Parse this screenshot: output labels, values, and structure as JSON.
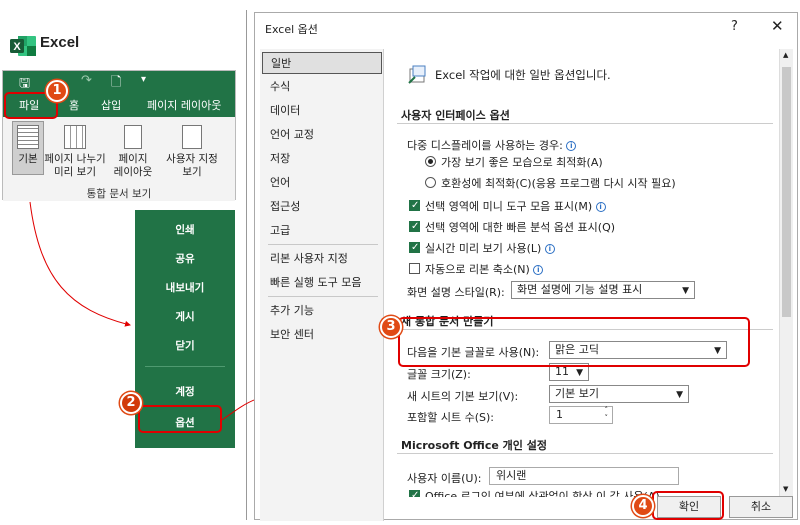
{
  "app": {
    "name": "Excel"
  },
  "ribbon": {
    "qat": {
      "save_icon": "save-icon",
      "undo_icon": "undo-icon",
      "redo_icon": "redo-icon",
      "preview_icon": "print-preview-icon",
      "more": "▾"
    },
    "tabs": [
      {
        "label": "파일"
      },
      {
        "label": "홈"
      },
      {
        "label": "삽입"
      },
      {
        "label": "페이지 레이아웃"
      }
    ],
    "view_buttons": [
      {
        "label_1": "기본",
        "label_2": ""
      },
      {
        "label_1": "페이지 나누기",
        "label_2": "미리 보기"
      },
      {
        "label_1": "페이지",
        "label_2": "레이아웃"
      },
      {
        "label_1": "사용자 지정",
        "label_2": "보기"
      }
    ],
    "group_label": "통합 문서 보기"
  },
  "backstage": {
    "items": [
      "인쇄",
      "공유",
      "내보내기",
      "게시",
      "닫기"
    ],
    "bottom_items": [
      "계정",
      "옵션"
    ]
  },
  "dialog": {
    "title": "Excel 옵션",
    "help": "?",
    "close": "✕",
    "nav": [
      "일반",
      "수식",
      "데이터",
      "언어 교정",
      "저장",
      "언어",
      "접근성",
      "고급",
      "리본 사용자 지정",
      "빠른 실행 도구 모음",
      "추가 기능",
      "보안 센터"
    ],
    "header_text": "Excel 작업에 대한 일반 옵션입니다.",
    "ui_section": {
      "title": "사용자 인터페이스 옵션",
      "multi_display_label": "다중 디스플레이를 사용하는 경우:",
      "radio_optimize": "가장 보기 좋은 모습으로 최적화(A)",
      "radio_compat": "호환성에 최적화(C)(응용 프로그램 다시 시작 필요)",
      "chk_mini_toolbar": "선택 영역에 미니 도구 모음 표시(M)",
      "chk_quick_analysis": "선택 영역에 대한 빠른 분석 옵션 표시(Q)",
      "chk_live_preview": "실시간 미리 보기 사용(L)",
      "chk_collapse_ribbon": "자동으로 리본 축소(N)",
      "screentip_label": "화면 설명 스타일(R):",
      "screentip_value": "화면 설명에 기능 설명 표시"
    },
    "new_wb_section": {
      "title": "새 통합 문서 만들기",
      "font_label": "다음을 기본 글꼴로 사용(N):",
      "font_value": "맑은 고딕",
      "size_label": "글꼴 크기(Z):",
      "size_value": "11",
      "view_label": "새 시트의 기본 보기(V):",
      "view_value": "기본 보기",
      "sheets_label": "포함할 시트 수(S):",
      "sheets_value": "1"
    },
    "office_section": {
      "title": "Microsoft Office 개인 설정",
      "username_label": "사용자 이름(U):",
      "username_value": "위시랜",
      "always_use_label": "Office 로그인 여부에 상관없이 항상 이 값 사용(A)"
    },
    "ok": "확인",
    "cancel": "취소"
  },
  "callouts": [
    "1",
    "2",
    "3",
    "4"
  ],
  "colors": {
    "excel_green": "#217346",
    "callout_red": "#e00000",
    "badge_orange": "#e04a15"
  }
}
